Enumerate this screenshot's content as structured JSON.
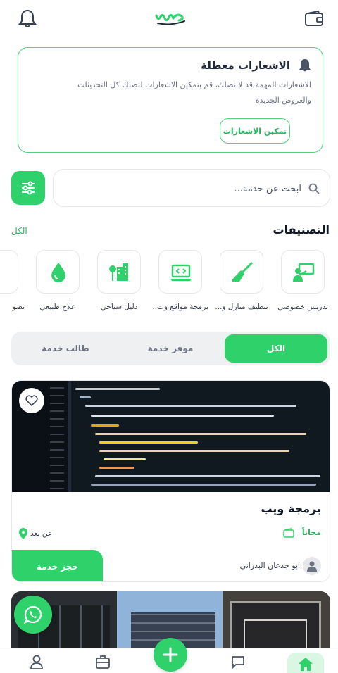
{
  "colors": {
    "accent": "#2ed16a",
    "accent_text": "#22b55a",
    "border": "#4fd27a"
  },
  "notice": {
    "title": "الاشعارات معطلة",
    "body": "الاشعارات المهمة قد لا تصلك، قم بتمكين الاشعارات لتصلك كل التحديثات والعروض الجديدة",
    "button": "تمكين الاشعارات"
  },
  "search": {
    "placeholder": "ابحث عن خدمة..."
  },
  "categories": {
    "title": "التصنيفات",
    "see_all": "الكل",
    "items": [
      {
        "label": "تدريس خصوصي",
        "icon": "teaching-icon"
      },
      {
        "label": "تنظيف منازل و...",
        "icon": "broom-icon"
      },
      {
        "label": "برمجة مواقع وت...",
        "icon": "laptop-code-icon"
      },
      {
        "label": "دليل سياحي",
        "icon": "city-trees-icon"
      },
      {
        "label": "علاج طبيعي",
        "icon": "water-drop-icon"
      },
      {
        "label": "تصو",
        "icon": ""
      }
    ]
  },
  "tabs": [
    "الكل",
    "موفر خدمة",
    "طالب خدمة"
  ],
  "service": {
    "title": "برمجة ويب",
    "price": "مجاناً",
    "mode": "عن بعد",
    "book_label": "حجز خدمة",
    "provider": "ابو جدعان البدراني"
  }
}
